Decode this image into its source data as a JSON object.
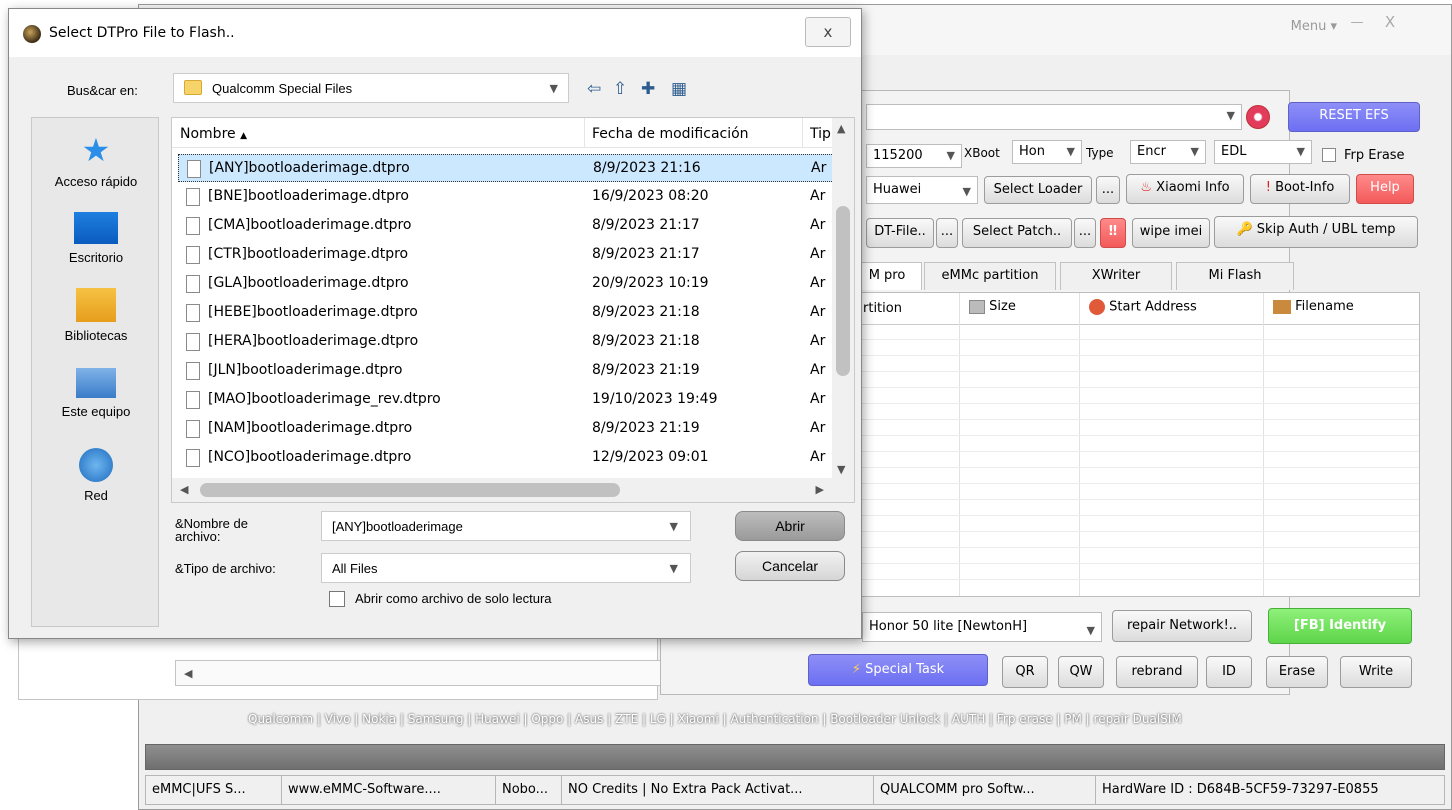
{
  "main_window": {
    "menu_label": "Menu ▾",
    "minimize": "—",
    "close": "X",
    "reset_efs": "RESET EFS",
    "row1": {
      "baud": "115200",
      "xboot_label": "XBoot",
      "hon": "Hon",
      "type_label": "Type",
      "encr": "Encr",
      "edl": "EDL",
      "frp_erase": "Frp Erase"
    },
    "row2": {
      "brand": "Huawei",
      "select_loader": "Select Loader",
      "dots": "...",
      "xiaomi_info": "Xiaomi Info",
      "boot_info": "Boot-Info",
      "help": "Help"
    },
    "row3": {
      "dt_file": "DT-File..",
      "dots1": "...",
      "select_patch": "Select Patch..",
      "dots2": "...",
      "wipe_imei": "wipe imei",
      "skip_auth": "Skip Auth / UBL temp"
    },
    "tabs": [
      "M pro",
      "eMMc partition",
      "XWriter",
      "Mi Flash"
    ],
    "grid_headers": [
      "rtition",
      "Size",
      "Start Address",
      "Filename"
    ],
    "model": "Honor 50 lite [NewtonH]",
    "repair_network": "repair Network!..",
    "fb_identify": "[FB] Identify",
    "special_task": "Special Task",
    "bottom_buttons": [
      "QR",
      "QW",
      "rebrand",
      "ID",
      "Erase",
      "Write"
    ],
    "marquee": "Qualcomm | Vivo | Nokia | Samsung | Huawei | Oppo | Asus | ZTE | LG | Xiaomi | Authentication | Bootloader Unlock | AUTH | Frp erase | PM | repair DualSIM",
    "status": [
      "eMMC|UFS S...",
      "www.eMMC-Software....",
      "Nobo...",
      "NO Credits | No Extra Pack Activat...",
      "QUALCOMM pro Softw...",
      "HardWare ID : D684B-5CF59-73297-E0855"
    ]
  },
  "dialog": {
    "title": "Select DTPro File to Flash..",
    "close": "x",
    "look_in_label": "Bus&car en:",
    "look_in_value": "Qualcomm Special Files",
    "places": [
      "Acceso rápido",
      "Escritorio",
      "Bibliotecas",
      "Este equipo",
      "Red"
    ],
    "columns": [
      "Nombre",
      "Fecha de modificación",
      "Tip"
    ],
    "files": [
      {
        "name": "[ANY]bootloaderimage.dtpro",
        "date": "8/9/2023 21:16",
        "type": "Ar"
      },
      {
        "name": "[BNE]bootloaderimage.dtpro",
        "date": "16/9/2023 08:20",
        "type": "Ar"
      },
      {
        "name": "[CMA]bootloaderimage.dtpro",
        "date": "8/9/2023 21:17",
        "type": "Ar"
      },
      {
        "name": "[CTR]bootloaderimage.dtpro",
        "date": "8/9/2023 21:17",
        "type": "Ar"
      },
      {
        "name": "[GLA]bootloaderimage.dtpro",
        "date": "20/9/2023 10:19",
        "type": "Ar"
      },
      {
        "name": "[HEBE]bootloaderimage.dtpro",
        "date": "8/9/2023 21:18",
        "type": "Ar"
      },
      {
        "name": "[HERA]bootloaderimage.dtpro",
        "date": "8/9/2023 21:18",
        "type": "Ar"
      },
      {
        "name": "[JLN]bootloaderimage.dtpro",
        "date": "8/9/2023 21:19",
        "type": "Ar"
      },
      {
        "name": "[MAO]bootloaderimage_rev.dtpro",
        "date": "19/10/2023 19:49",
        "type": "Ar"
      },
      {
        "name": "[NAM]bootloaderimage.dtpro",
        "date": "8/9/2023 21:19",
        "type": "Ar"
      },
      {
        "name": "[NCO]bootloaderimage.dtpro",
        "date": "12/9/2023 09:01",
        "type": "Ar"
      }
    ],
    "filename_label": "&Nombre de archivo:",
    "filename_value": "[ANY]bootloaderimage",
    "filetype_label": "&Tipo de archivo:",
    "filetype_value": "All Files",
    "open_button": "Abrir",
    "cancel_button": "Cancelar",
    "readonly_label": "Abrir como archivo de solo lectura"
  }
}
